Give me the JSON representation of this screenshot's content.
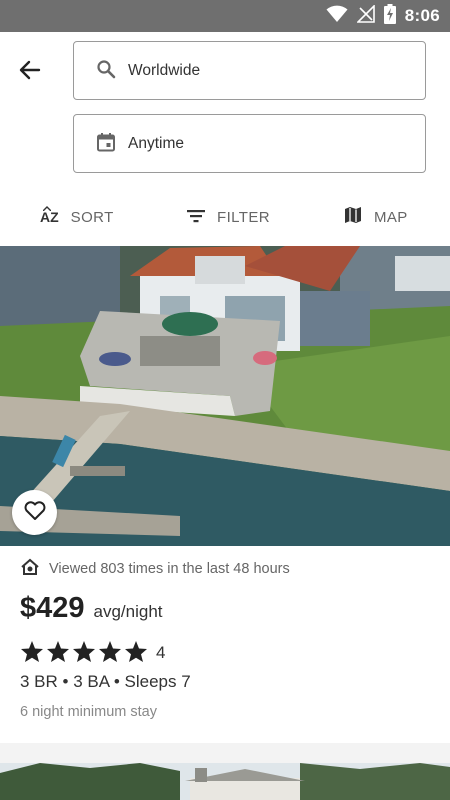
{
  "status_bar": {
    "time": "8:06",
    "icons": [
      "wifi-icon",
      "signal-icon",
      "battery-charging-icon"
    ]
  },
  "search": {
    "location_value": "Worldwide",
    "dates_value": "Anytime"
  },
  "toolbar": {
    "sort_label": "SORT",
    "sort_icon_text": "AZ",
    "filter_label": "FILTER",
    "map_label": "MAP"
  },
  "listing": {
    "viewed_text": "Viewed 803 times in the last 48 hours",
    "price": "$429",
    "price_unit": "avg/night",
    "rating": 5,
    "review_count": "4",
    "details": "3 BR • 3 BA • Sleeps 7",
    "min_stay": "6 night minimum stay"
  },
  "colors": {
    "status_bar": "#6f6f6f",
    "text_primary": "#222222",
    "text_secondary": "#666666",
    "field_border": "#9a9a9a",
    "divider": "#f3f3f3"
  }
}
